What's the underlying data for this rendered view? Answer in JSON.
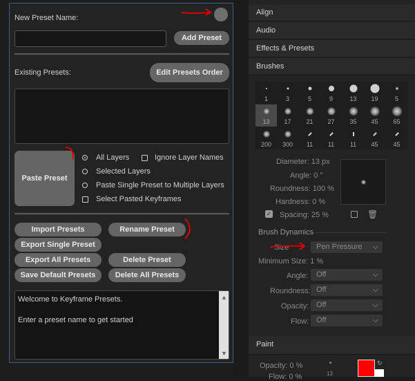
{
  "left": {
    "new_preset_label": "New Preset Name:",
    "new_preset_value": "",
    "add_preset": "Add Preset",
    "existing_label": "Existing  Presets:",
    "edit_order": "Edit Presets Order",
    "paste_preset": "Paste Preset",
    "options": {
      "all_layers": "All Layers",
      "ignore_layer_names": "Ignore Layer Names",
      "selected_layers": "Selected Layers",
      "paste_single": "Paste Single Preset to Multiple Layers",
      "select_pasted": "Select Pasted Keyframes"
    },
    "buttons": {
      "import": "Import Presets",
      "rename": "Rename Preset",
      "export_single": "Export Single Preset",
      "export_all": "Export All Presets",
      "delete": "Delete Preset",
      "save_default": "Save Default Presets",
      "delete_all": "Delete All Presets"
    },
    "log": {
      "line1": "Welcome to Keyframe Presets.",
      "line2": "Enter a preset name to get started"
    }
  },
  "right": {
    "sections": {
      "align": "Align",
      "audio": "Audio",
      "effects": "Effects & Presets",
      "brushes": "Brushes",
      "paint": "Paint"
    },
    "brush_sizes": [
      "1",
      "3",
      "5",
      "9",
      "13",
      "19",
      "5",
      "13",
      "17",
      "21",
      "27",
      "35",
      "45",
      "65",
      "200",
      "300",
      "11",
      "11",
      "11",
      "45",
      "45"
    ],
    "diameter": "Diameter: 13 px",
    "angle": "Angle: 0 °",
    "roundness": "Roundness: 100 %",
    "hardness": "Hardness: 0 %",
    "spacing": "Spacing: 25 %",
    "dynamics_title": "Brush Dynamics",
    "size_label": "Size",
    "size_value": "Pen Pressure",
    "min_size": "Minimum Size: 1 %",
    "angle_label": "Angle:",
    "roundness_label": "Roundness:",
    "opacity_label": "Opacity:",
    "flow_label": "Flow:",
    "off": "Off",
    "paint_opacity": "Opacity: 0 %",
    "paint_flow": "Flow: 0 %",
    "paint_brush_num": "13",
    "accent_red": "#ff0000"
  }
}
